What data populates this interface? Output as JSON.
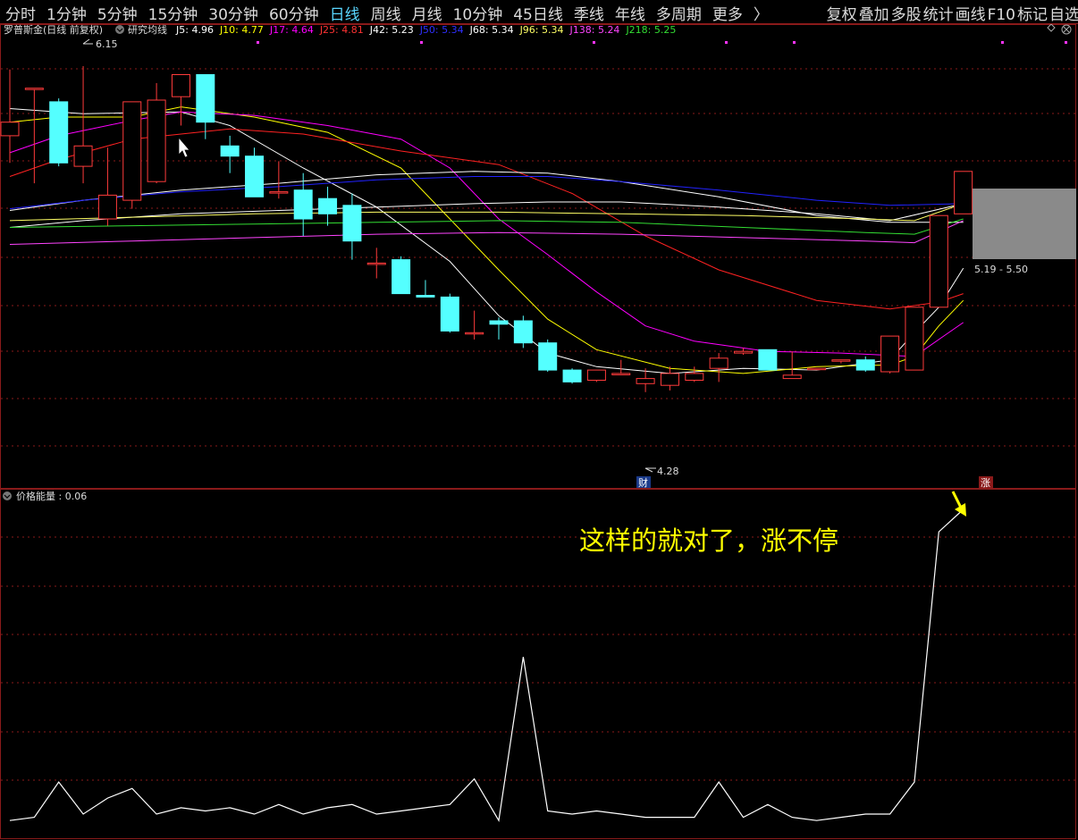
{
  "toolbar": {
    "periods": [
      "分时",
      "1分钟",
      "5分钟",
      "15分钟",
      "30分钟",
      "60分钟",
      "日线",
      "周线",
      "月线",
      "10分钟",
      "45日线",
      "季线",
      "年线",
      "多周期",
      "更多"
    ],
    "active_period": "日线",
    "more_arrow": "〉",
    "right_tools": [
      "复权",
      "叠加",
      "多股",
      "统计",
      "画线",
      "F10",
      "标记",
      "自选"
    ]
  },
  "main_panel": {
    "stock_title": "罗普斯金(日线 前复权)",
    "indicator_name": "研究均线",
    "ma_labels": [
      {
        "text": "J5: 4.96",
        "color": "#ffffff"
      },
      {
        "text": "J10: 4.77",
        "color": "#ffff00"
      },
      {
        "text": "J17: 4.64",
        "color": "#ff00ff"
      },
      {
        "text": "J25: 4.81",
        "color": "#ff3333"
      },
      {
        "text": "J42: 5.23",
        "color": "#ffffff"
      },
      {
        "text": "J50: 5.34",
        "color": "#2f2fff"
      },
      {
        "text": "J68: 5.34",
        "color": "#ffffff"
      },
      {
        "text": "J96: 5.34",
        "color": "#ffff66"
      },
      {
        "text": "J138: 5.24",
        "color": "#ff44ff"
      },
      {
        "text": "J218: 5.25",
        "color": "#33dd33"
      }
    ],
    "high_label": "6.15",
    "low_label": "4.28",
    "range_label": "5.19 - 5.50",
    "cai_badge": "财",
    "zhang_badge": "涨"
  },
  "sub_panel": {
    "indicator_label": "价格能量 : 0.06",
    "annotation": "这样的就对了，涨不停"
  },
  "colors": {
    "up": "#ff3b3b",
    "down": "#54ffff",
    "grid": "#8a1a1a",
    "border": "#8a1a1a",
    "annotation": "#ffff00",
    "energy_line": "#ffffff"
  },
  "chart_data": [
    {
      "type": "candlestick",
      "title": "罗普斯金(日线 前复权)",
      "ylim": [
        3.9,
        6.4
      ],
      "candles": [
        {
          "o": 5.74,
          "h": 6.13,
          "l": 5.58,
          "c": 5.82
        },
        {
          "o": 6.02,
          "h": 6.02,
          "l": 5.46,
          "c": 6.02
        },
        {
          "o": 5.94,
          "h": 5.96,
          "l": 5.56,
          "c": 5.58
        },
        {
          "o": 5.56,
          "h": 6.15,
          "l": 5.46,
          "c": 5.68
        },
        {
          "o": 5.25,
          "h": 5.67,
          "l": 5.21,
          "c": 5.39
        },
        {
          "o": 5.36,
          "h": 5.54,
          "l": 5.31,
          "c": 5.94
        },
        {
          "o": 5.47,
          "h": 6.05,
          "l": 5.46,
          "c": 5.95
        },
        {
          "o": 5.97,
          "h": 6.07,
          "l": 5.8,
          "c": 6.1
        },
        {
          "o": 6.1,
          "h": 6.1,
          "l": 5.72,
          "c": 5.82
        },
        {
          "o": 5.68,
          "h": 5.74,
          "l": 5.52,
          "c": 5.62
        },
        {
          "o": 5.62,
          "h": 5.67,
          "l": 5.4,
          "c": 5.38
        },
        {
          "o": 5.41,
          "h": 5.59,
          "l": 5.37,
          "c": 5.41
        },
        {
          "o": 5.42,
          "h": 5.52,
          "l": 5.15,
          "c": 5.25
        },
        {
          "o": 5.37,
          "h": 5.44,
          "l": 5.21,
          "c": 5.28
        },
        {
          "o": 5.33,
          "h": 5.4,
          "l": 5.01,
          "c": 5.12
        },
        {
          "o": 4.99,
          "h": 5.08,
          "l": 4.9,
          "c": 4.99
        },
        {
          "o": 5.01,
          "h": 5.03,
          "l": 4.81,
          "c": 4.81
        },
        {
          "o": 4.8,
          "h": 4.89,
          "l": 4.79,
          "c": 4.79
        },
        {
          "o": 4.79,
          "h": 4.81,
          "l": 4.58,
          "c": 4.59
        },
        {
          "o": 4.58,
          "h": 4.71,
          "l": 4.54,
          "c": 4.58
        },
        {
          "o": 4.65,
          "h": 4.67,
          "l": 4.54,
          "c": 4.63
        },
        {
          "o": 4.65,
          "h": 4.68,
          "l": 4.49,
          "c": 4.52
        },
        {
          "o": 4.52,
          "h": 4.54,
          "l": 4.35,
          "c": 4.36
        },
        {
          "o": 4.36,
          "h": 4.37,
          "l": 4.28,
          "c": 4.29
        },
        {
          "o": 4.3,
          "h": 4.36,
          "l": 4.29,
          "c": 4.36
        },
        {
          "o": 4.34,
          "h": 4.42,
          "l": 4.34,
          "c": 4.34
        },
        {
          "o": 4.28,
          "h": 4.37,
          "l": 4.23,
          "c": 4.31
        },
        {
          "o": 4.27,
          "h": 4.38,
          "l": 4.24,
          "c": 4.34
        },
        {
          "o": 4.3,
          "h": 4.38,
          "l": 4.29,
          "c": 4.34
        },
        {
          "o": 4.37,
          "h": 4.46,
          "l": 4.29,
          "c": 4.43
        },
        {
          "o": 4.46,
          "h": 4.49,
          "l": 4.45,
          "c": 4.47
        },
        {
          "o": 4.48,
          "h": 4.46,
          "l": 4.36,
          "c": 4.36
        },
        {
          "o": 4.31,
          "h": 4.47,
          "l": 4.31,
          "c": 4.33
        },
        {
          "o": 4.37,
          "h": 4.37,
          "l": 4.37,
          "c": 4.37
        },
        {
          "o": 4.42,
          "h": 4.42,
          "l": 4.4,
          "c": 4.42
        },
        {
          "o": 4.42,
          "h": 4.44,
          "l": 4.35,
          "c": 4.36
        },
        {
          "o": 4.35,
          "h": 4.56,
          "l": 4.34,
          "c": 4.56
        },
        {
          "o": 4.36,
          "h": 4.58,
          "l": 4.36,
          "c": 4.73
        },
        {
          "o": 4.73,
          "h": 4.79,
          "l": 4.73,
          "c": 5.27
        },
        {
          "o": 5.28,
          "h": 5.53,
          "l": 5.28,
          "c": 5.53
        }
      ],
      "ma_lines": [
        {
          "name": "J5",
          "color": "#ffffff",
          "points": [
            [
              0,
              5.9
            ],
            [
              3,
              5.87
            ],
            [
              7,
              5.88
            ],
            [
              9,
              5.8
            ],
            [
              12,
              5.55
            ],
            [
              15,
              5.32
            ],
            [
              18,
              5.0
            ],
            [
              20,
              4.68
            ],
            [
              22,
              4.46
            ],
            [
              24,
              4.38
            ],
            [
              27,
              4.34
            ],
            [
              30,
              4.37
            ],
            [
              33,
              4.36
            ],
            [
              36,
              4.42
            ],
            [
              37,
              4.58
            ],
            [
              38,
              4.73
            ],
            [
              39,
              4.96
            ]
          ]
        },
        {
          "name": "J10",
          "color": "#ffff00",
          "points": [
            [
              0,
              5.82
            ],
            [
              2,
              5.85
            ],
            [
              5,
              5.85
            ],
            [
              7,
              5.91
            ],
            [
              10,
              5.85
            ],
            [
              13,
              5.76
            ],
            [
              16,
              5.55
            ],
            [
              18,
              5.25
            ],
            [
              20,
              4.95
            ],
            [
              22,
              4.66
            ],
            [
              24,
              4.48
            ],
            [
              27,
              4.37
            ],
            [
              30,
              4.34
            ],
            [
              33,
              4.38
            ],
            [
              36,
              4.39
            ],
            [
              37,
              4.44
            ],
            [
              38,
              4.62
            ],
            [
              39,
              4.77
            ]
          ]
        },
        {
          "name": "J17",
          "color": "#ff00ff",
          "points": [
            [
              0,
              5.64
            ],
            [
              2,
              5.74
            ],
            [
              5,
              5.83
            ],
            [
              7,
              5.88
            ],
            [
              10,
              5.86
            ],
            [
              13,
              5.8
            ],
            [
              16,
              5.72
            ],
            [
              18,
              5.55
            ],
            [
              20,
              5.25
            ],
            [
              22,
              5.04
            ],
            [
              24,
              4.82
            ],
            [
              26,
              4.62
            ],
            [
              28,
              4.53
            ],
            [
              31,
              4.47
            ],
            [
              34,
              4.46
            ],
            [
              37,
              4.44
            ],
            [
              38,
              4.54
            ],
            [
              39,
              4.64
            ]
          ]
        },
        {
          "name": "J25",
          "color": "#ff2222",
          "points": [
            [
              0,
              5.5
            ],
            [
              2,
              5.6
            ],
            [
              5,
              5.72
            ],
            [
              9,
              5.78
            ],
            [
              12,
              5.75
            ],
            [
              16,
              5.65
            ],
            [
              20,
              5.57
            ],
            [
              23,
              5.4
            ],
            [
              26,
              5.15
            ],
            [
              29,
              4.95
            ],
            [
              33,
              4.77
            ],
            [
              36,
              4.72
            ],
            [
              38,
              4.76
            ],
            [
              39,
              4.81
            ]
          ]
        },
        {
          "name": "J42",
          "color": "#ffffff",
          "points": [
            [
              0,
              5.3
            ],
            [
              3,
              5.36
            ],
            [
              7,
              5.42
            ],
            [
              11,
              5.46
            ],
            [
              15,
              5.51
            ],
            [
              19,
              5.53
            ],
            [
              22,
              5.52
            ],
            [
              25,
              5.47
            ],
            [
              29,
              5.38
            ],
            [
              33,
              5.27
            ],
            [
              36,
              5.23
            ],
            [
              39,
              5.23
            ]
          ]
        },
        {
          "name": "J50",
          "color": "#2222ff",
          "points": [
            [
              0,
              5.31
            ],
            [
              3,
              5.36
            ],
            [
              7,
              5.41
            ],
            [
              11,
              5.44
            ],
            [
              15,
              5.48
            ],
            [
              19,
              5.5
            ],
            [
              22,
              5.5
            ],
            [
              25,
              5.47
            ],
            [
              29,
              5.42
            ],
            [
              33,
              5.36
            ],
            [
              36,
              5.33
            ],
            [
              39,
              5.34
            ]
          ]
        },
        {
          "name": "J68",
          "color": "#ffffff",
          "points": [
            [
              0,
              5.2
            ],
            [
              3,
              5.24
            ],
            [
              7,
              5.28
            ],
            [
              11,
              5.3
            ],
            [
              15,
              5.32
            ],
            [
              19,
              5.34
            ],
            [
              22,
              5.35
            ],
            [
              25,
              5.35
            ],
            [
              29,
              5.32
            ],
            [
              33,
              5.28
            ],
            [
              36,
              5.24
            ],
            [
              39,
              5.34
            ]
          ]
        },
        {
          "name": "J96",
          "color": "#ffff66",
          "points": [
            [
              0,
              5.24
            ],
            [
              5,
              5.26
            ],
            [
              10,
              5.28
            ],
            [
              15,
              5.29
            ],
            [
              20,
              5.29
            ],
            [
              25,
              5.28
            ],
            [
              30,
              5.27
            ],
            [
              35,
              5.25
            ],
            [
              37,
              5.24
            ],
            [
              39,
              5.34
            ]
          ]
        },
        {
          "name": "J138",
          "color": "#ff44ff",
          "points": [
            [
              0,
              5.1
            ],
            [
              5,
              5.12
            ],
            [
              10,
              5.14
            ],
            [
              15,
              5.16
            ],
            [
              20,
              5.17
            ],
            [
              25,
              5.16
            ],
            [
              30,
              5.14
            ],
            [
              35,
              5.12
            ],
            [
              37,
              5.11
            ],
            [
              39,
              5.24
            ]
          ]
        },
        {
          "name": "J218",
          "color": "#33dd33",
          "points": [
            [
              0,
              5.2
            ],
            [
              5,
              5.21
            ],
            [
              10,
              5.22
            ],
            [
              15,
              5.23
            ],
            [
              20,
              5.24
            ],
            [
              25,
              5.23
            ],
            [
              30,
              5.2
            ],
            [
              35,
              5.17
            ],
            [
              37,
              5.16
            ],
            [
              39,
              5.25
            ]
          ]
        }
      ]
    },
    {
      "type": "line",
      "title": "价格能量",
      "ylim": [
        0,
        1
      ],
      "series": [
        {
          "name": "价格能量",
          "values": [
            0.03,
            0.04,
            0.15,
            0.05,
            0.1,
            0.13,
            0.05,
            0.07,
            0.06,
            0.07,
            0.05,
            0.08,
            0.05,
            0.07,
            0.08,
            0.05,
            0.06,
            0.07,
            0.08,
            0.16,
            0.03,
            0.54,
            0.06,
            0.05,
            0.06,
            0.05,
            0.04,
            0.04,
            0.04,
            0.15,
            0.04,
            0.08,
            0.04,
            0.03,
            0.04,
            0.05,
            0.05,
            0.15,
            0.93,
            1.0
          ]
        }
      ]
    }
  ]
}
